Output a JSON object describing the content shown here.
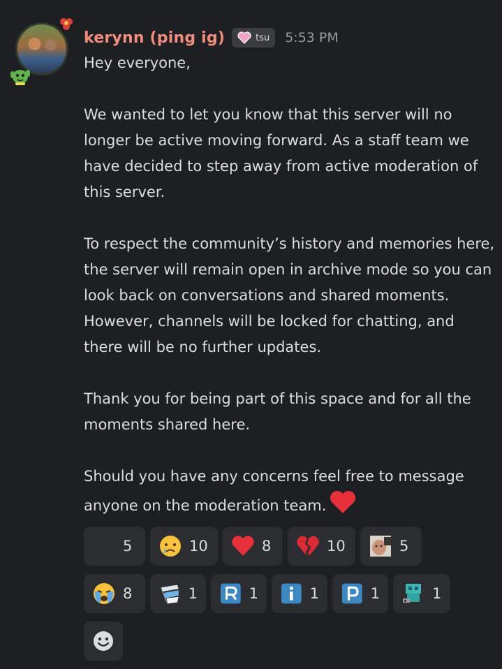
{
  "message": {
    "username": "kerynn (ping ig)",
    "tag_text": "tsu",
    "timestamp": "5:53 PM",
    "paragraphs": [
      "Hey everyone,",
      "We wanted to let you know that this server will no longer be active moving forward. As a staff team we have decided to step away from active moderation of this server.",
      "To respect the community’s history and memories here, the server will remain open in archive mode so you can look back on conversations and shared moments. However, channels will be locked for chatting, and there will be no further updates.",
      "Thank you for being part of this space and for all the moments shared here.",
      "Should you have any concerns feel free to message anyone on the moderation team."
    ]
  },
  "reactions": [
    {
      "icon": "blank-emoji-icon",
      "count": "5"
    },
    {
      "icon": "crying-face-icon",
      "count": "10"
    },
    {
      "icon": "red-heart-icon",
      "count": "8"
    },
    {
      "icon": "broken-heart-icon",
      "count": "10"
    },
    {
      "icon": "custom-face-emoji-icon",
      "count": "5"
    },
    {
      "icon": "sobbing-face-icon",
      "count": "8"
    },
    {
      "icon": "custom-blocks-emoji-icon",
      "count": "1"
    },
    {
      "icon": "letter-r-icon",
      "count": "1"
    },
    {
      "icon": "letter-i-icon",
      "count": "1"
    },
    {
      "icon": "letter-p-icon",
      "count": "1"
    },
    {
      "icon": "custom-pixel-emoji-icon",
      "count": "1"
    }
  ],
  "colors": {
    "background": "#1e1f22",
    "username": "#f08d7d",
    "text": "#dbdee1",
    "timestamp": "#949ba4",
    "reaction_bg": "#2b2d31",
    "tag_bg": "#3a3c42"
  }
}
